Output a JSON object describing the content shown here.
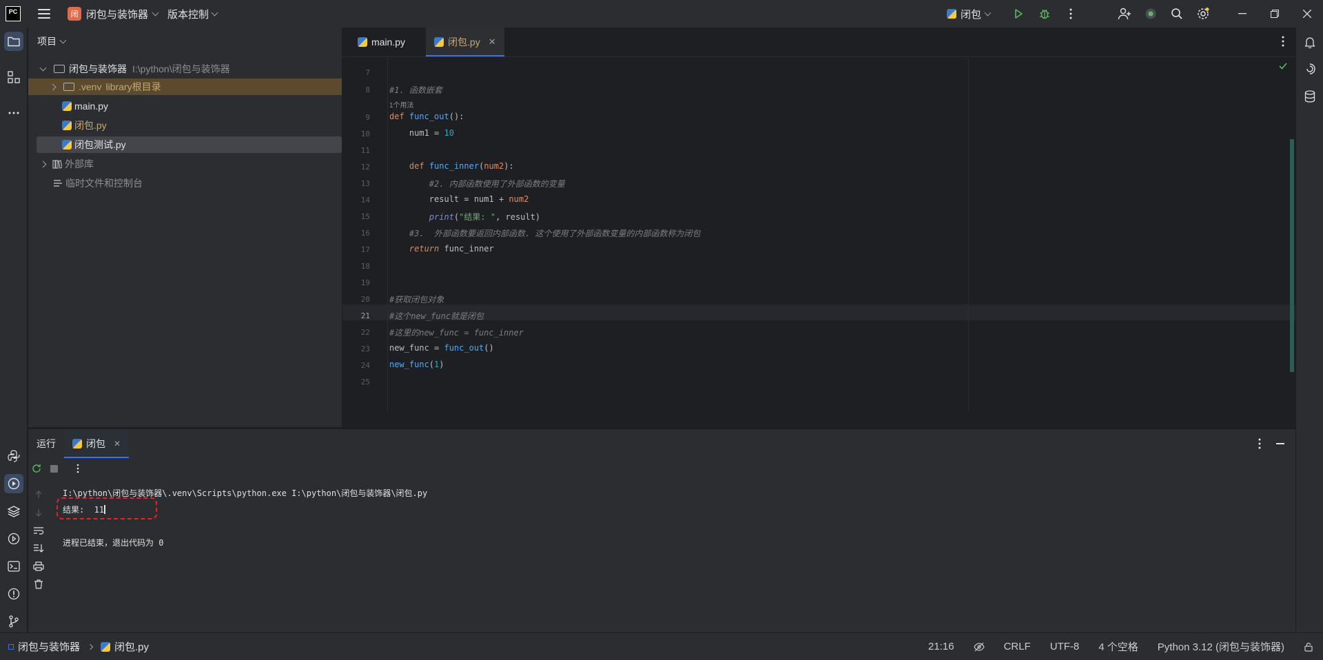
{
  "titlebar": {
    "project_badge": "闭",
    "project_name": "闭包与装饰器",
    "vcs_label": "版本控制",
    "run_config": "闭包"
  },
  "project_panel": {
    "header": "项目",
    "root_name": "闭包与装饰器",
    "root_path": "I:\\python\\闭包与装饰器",
    "venv_name": ".venv",
    "venv_note": "library根目录",
    "files": [
      "main.py",
      "闭包.py",
      "闭包测试.py"
    ],
    "external_libs": "外部库",
    "scratches": "临时文件和控制台"
  },
  "editor": {
    "tabs": [
      {
        "label": "main.py"
      },
      {
        "label": "闭包.py"
      }
    ],
    "usage_hint": "1个用法",
    "line_numbers": [
      "7",
      "8",
      "9",
      "10",
      "11",
      "12",
      "13",
      "14",
      "15",
      "16",
      "17",
      "18",
      "19",
      "20",
      "21",
      "22",
      "23",
      "24",
      "25"
    ],
    "current_line": "21"
  },
  "run_panel": {
    "title": "运行",
    "tab_label": "闭包",
    "command_line": "I:\\python\\闭包与装饰器\\.venv\\Scripts\\python.exe I:\\python\\闭包与装饰器\\闭包.py",
    "output_line": "结果:  11",
    "exit_line": "进程已结束，退出代码为 0"
  },
  "statusbar": {
    "crumb_project": "闭包与装饰器",
    "crumb_file": "闭包.py",
    "position": "21:16",
    "line_ending": "CRLF",
    "encoding": "UTF-8",
    "indent": "4 个空格",
    "interpreter": "Python 3.12 (闭包与装饰器)"
  },
  "colors": {
    "accent": "#3574f0",
    "venv_highlight": "#5b4a2e",
    "annotation_red": "#e0262b"
  }
}
